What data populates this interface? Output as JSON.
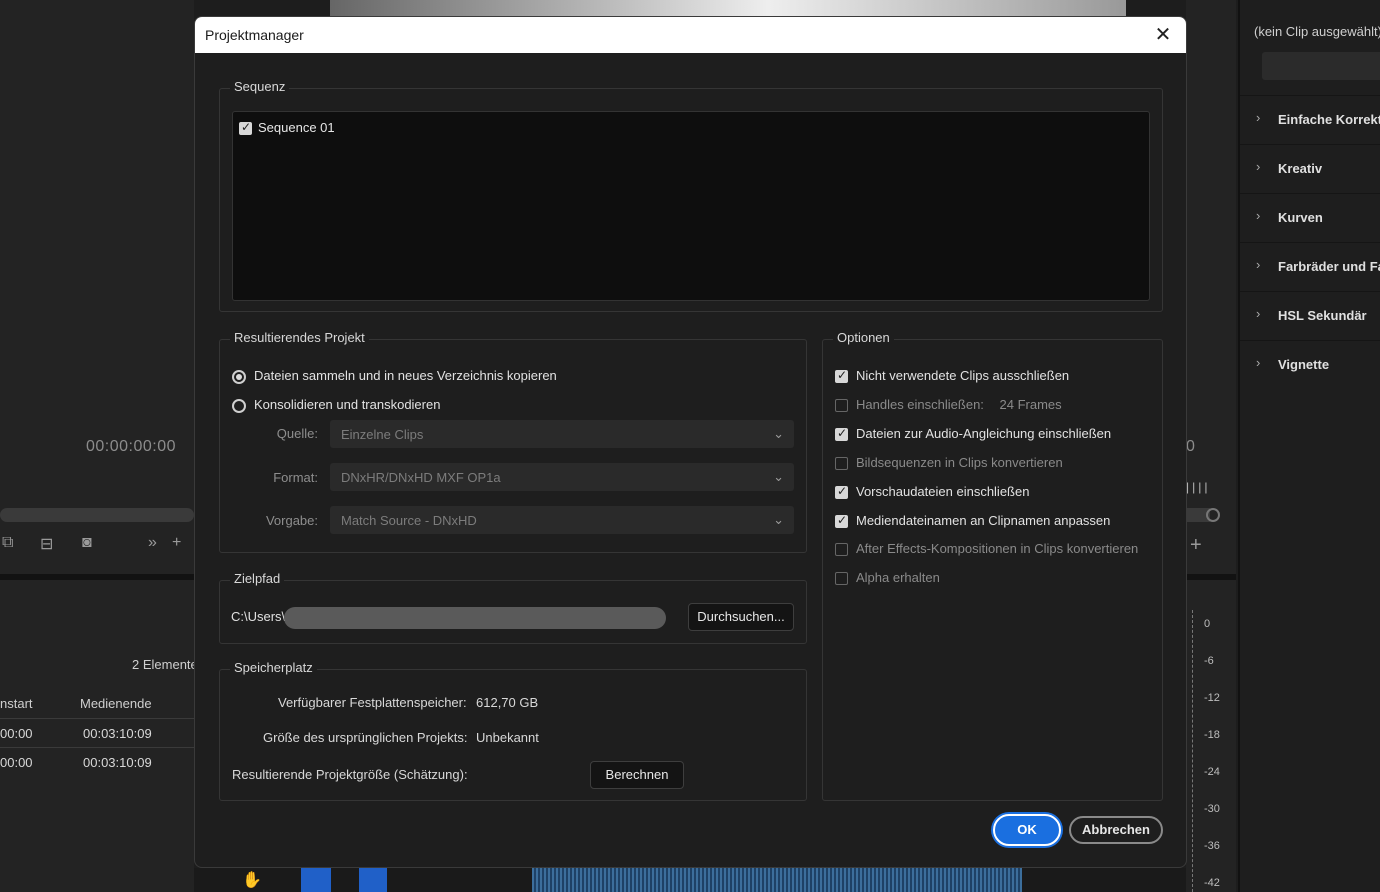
{
  "background": {
    "left_timecode": "00:00:00:00",
    "elements_count": "2 Elemente",
    "columns": [
      "nstart",
      "Medienende"
    ],
    "rows": [
      {
        "start": "00:00",
        "end": "00:03:10:09"
      },
      {
        "start": "00:00",
        "end": "00:03:10:09"
      }
    ],
    "right_panel": {
      "no_clip": "(kein Clip ausgewählt)",
      "sections": [
        "Einfache Korrektur",
        "Kreativ",
        "Kurven",
        "Farbräder und Fa",
        "HSL Sekundär",
        "Vignette"
      ]
    },
    "mid_timecode": "0",
    "meter_ticks": [
      "0",
      "-6",
      "-12",
      "-18",
      "-24",
      "-30",
      "-36",
      "-42"
    ]
  },
  "dialog": {
    "title": "Projektmanager",
    "close_icon": "close-icon",
    "sequence": {
      "legend": "Sequenz",
      "items": [
        {
          "label": "Sequence 01",
          "checked": true
        }
      ]
    },
    "result": {
      "legend": "Resultierendes Projekt",
      "radio1": "Dateien sammeln und in neues Verzeichnis kopieren",
      "radio2": "Konsolidieren und transkodieren",
      "source_label": "Quelle:",
      "source_value": "Einzelne Clips",
      "format_label": "Format:",
      "format_value": "DNxHR/DNxHD MXF OP1a",
      "preset_label": "Vorgabe:",
      "preset_value": "Match Source - DNxHD"
    },
    "options": {
      "legend": "Optionen",
      "items": [
        {
          "label": "Nicht verwendete Clips ausschließen",
          "checked": true,
          "enabled": true
        },
        {
          "label": "Handles einschließen:",
          "checked": false,
          "enabled": false,
          "extra": "24 Frames"
        },
        {
          "label": "Dateien zur Audio-Angleichung einschließen",
          "checked": true,
          "enabled": true
        },
        {
          "label": "Bildsequenzen in Clips konvertieren",
          "checked": false,
          "enabled": false
        },
        {
          "label": "Vorschaudateien einschließen",
          "checked": true,
          "enabled": true
        },
        {
          "label": "Mediendateinamen an Clipnamen anpassen",
          "checked": true,
          "enabled": true
        },
        {
          "label": "After Effects-Kompositionen in Clips konvertieren",
          "checked": false,
          "enabled": false
        },
        {
          "label": "Alpha erhalten",
          "checked": false,
          "enabled": false
        }
      ]
    },
    "target": {
      "legend": "Zielpfad",
      "path_prefix": "C:\\Users\\",
      "browse": "Durchsuchen..."
    },
    "storage": {
      "legend": "Speicherplatz",
      "free_label": "Verfügbarer Festplattenspeicher:",
      "free_value": "612,70 GB",
      "orig_label": "Größe des ursprünglichen Projekts:",
      "orig_value": "Unbekannt",
      "result_label": "Resultierende Projektgröße (Schätzung):",
      "calc_button": "Berechnen"
    },
    "ok": "OK",
    "cancel": "Abbrechen"
  }
}
